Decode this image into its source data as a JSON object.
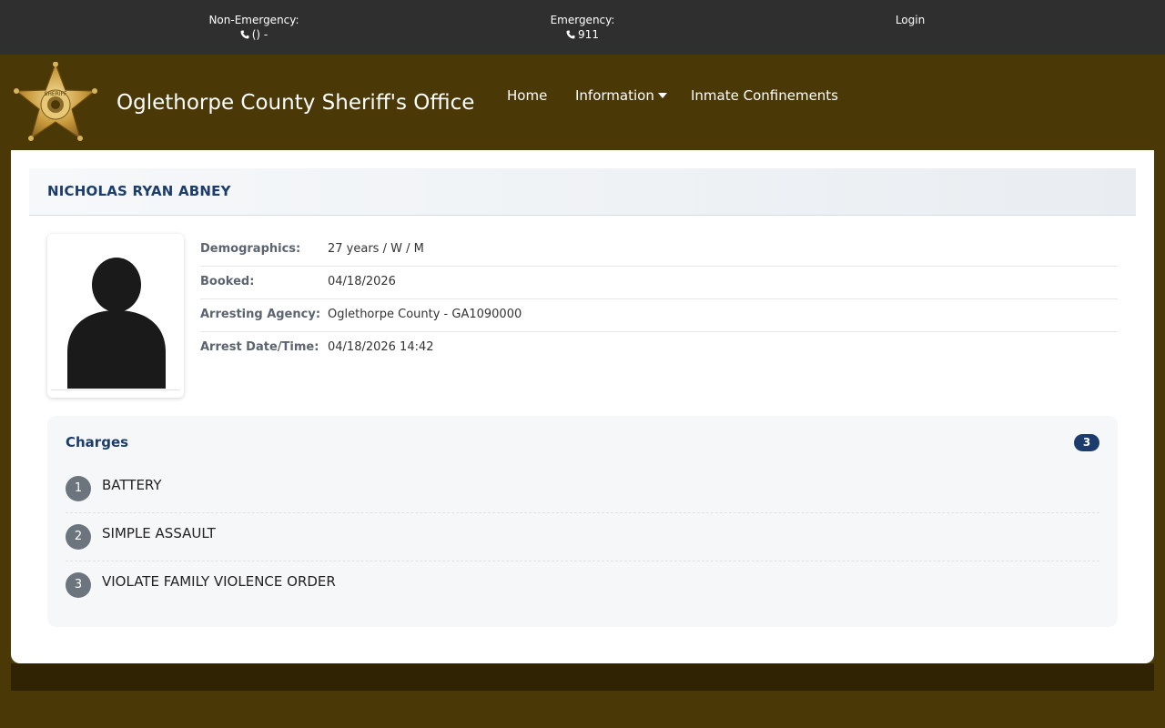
{
  "topbar": {
    "non_emergency_label": "Non-Emergency:",
    "non_emergency_value": "() -",
    "emergency_label": "Emergency:",
    "emergency_value": "911",
    "login_label": "Login"
  },
  "header": {
    "badge_text": "SHERIFF",
    "title": "Oglethorpe County Sheriff's Office",
    "nav": {
      "home": "Home",
      "information": "Information",
      "inmate_confinements": "Inmate Confinements"
    }
  },
  "inmate": {
    "name": "NICHOLAS RYAN ABNEY",
    "details": [
      {
        "label": "Demographics:",
        "value": "27 years / W / M"
      },
      {
        "label": "Booked:",
        "value": "04/18/2026"
      },
      {
        "label": "Arresting Agency:",
        "value": "Oglethorpe County - GA1090000"
      },
      {
        "label": "Arrest Date/Time:",
        "value": "04/18/2026 14:42"
      }
    ]
  },
  "charges": {
    "title": "Charges",
    "count": "3",
    "items": [
      {
        "num": "1",
        "text": "BATTERY"
      },
      {
        "num": "2",
        "text": "SIMPLE ASSAULT"
      },
      {
        "num": "3",
        "text": "VIOLATE FAMILY VIOLENCE ORDER"
      }
    ]
  },
  "colors": {
    "brand_brown": "#4a3806",
    "topbar": "#2f2f2f",
    "navy": "#1c3d6b",
    "charge_badge": "#6c757d"
  },
  "icons": {
    "phone": "phone-icon",
    "caret": "caret-down-icon",
    "badge": "sheriff-star-badge-icon",
    "avatar": "person-silhouette-icon"
  }
}
